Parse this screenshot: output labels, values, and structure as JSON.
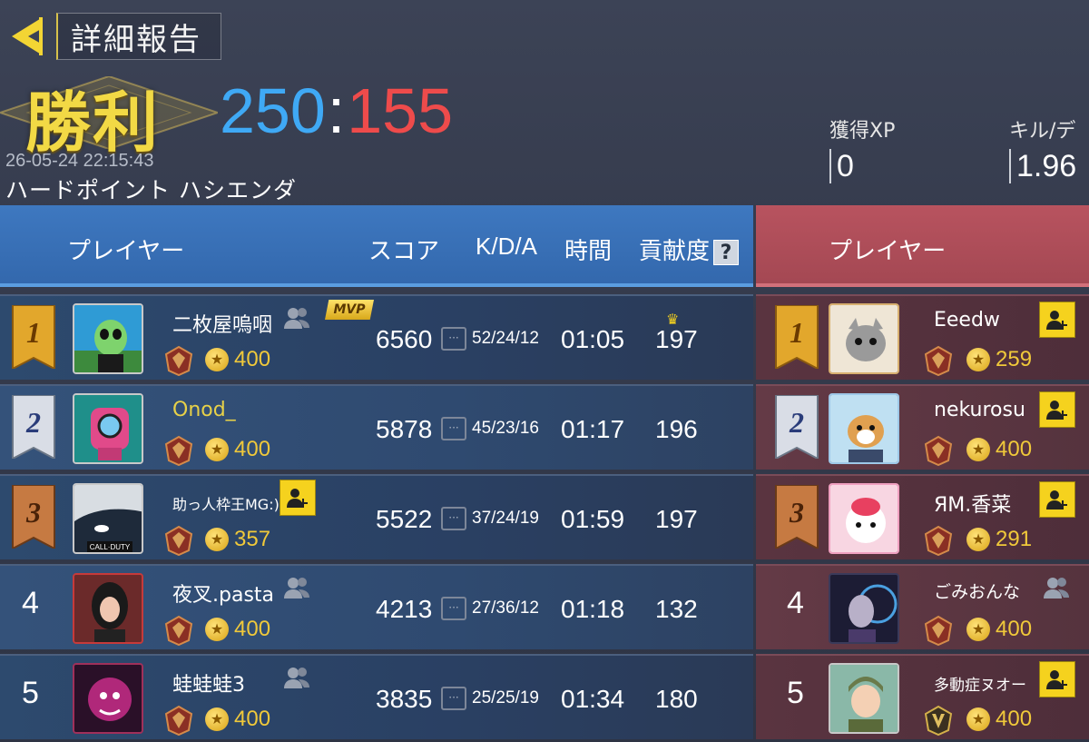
{
  "header": {
    "back_icon": "back-arrow-icon",
    "title": "詳細報告",
    "result": "勝利",
    "score_ally": "250",
    "score_sep": ":",
    "score_enemy": "155",
    "datetime": "26-05-24 22:15:43",
    "mode_map": "ハードポイント ハシエンダ",
    "xp_label": "獲得XP",
    "xp_value": "0",
    "kd_label": "キル/デ",
    "kd_value": "1.96"
  },
  "columns": {
    "player": "プレイヤー",
    "score": "スコア",
    "kda": "K/D/A",
    "time": "時間",
    "contribution": "貢献度",
    "help": "?",
    "enemy_player": "プレイヤー"
  },
  "colors": {
    "ally": "#3fa9f5",
    "enemy": "#ee4b4b",
    "victory": "#f2d945",
    "coin": "#f0c93a"
  },
  "ally_players": [
    {
      "rank": "1",
      "name": "二枚屋嗚咽",
      "currency": "400",
      "mvp": "MVP",
      "score": "6560",
      "kda": "52/24/12",
      "time": "01:05",
      "contribution": "197",
      "icon": "party-icon"
    },
    {
      "rank": "2",
      "name": "Onod_",
      "currency": "400",
      "score": "5878",
      "kda": "45/23/16",
      "time": "01:17",
      "contribution": "196",
      "icon": ""
    },
    {
      "rank": "3",
      "name": "助っ人枠王MG:)",
      "currency": "357",
      "score": "5522",
      "kda": "37/24/19",
      "time": "01:59",
      "contribution": "197",
      "icon": "add-friend-icon"
    },
    {
      "rank": "4",
      "name": "夜叉.pasta",
      "currency": "400",
      "score": "4213",
      "kda": "27/36/12",
      "time": "01:18",
      "contribution": "132",
      "icon": "party-icon"
    },
    {
      "rank": "5",
      "name": "蛙蛙蛙3",
      "currency": "400",
      "score": "3835",
      "kda": "25/25/19",
      "time": "01:34",
      "contribution": "180",
      "icon": "party-icon"
    }
  ],
  "enemy_players": [
    {
      "rank": "1",
      "name": "Eeedw",
      "currency": "259",
      "icon": "add-friend-icon"
    },
    {
      "rank": "2",
      "name": "nekurosu",
      "currency": "400",
      "icon": "add-friend-icon"
    },
    {
      "rank": "3",
      "name": "ЯM.香菜",
      "currency": "291",
      "icon": "add-friend-icon"
    },
    {
      "rank": "4",
      "name": "ごみおんな",
      "currency": "400",
      "icon": "party-icon"
    },
    {
      "rank": "5",
      "name": "多動症ヌオー",
      "currency": "400",
      "icon": "add-friend-icon"
    }
  ]
}
